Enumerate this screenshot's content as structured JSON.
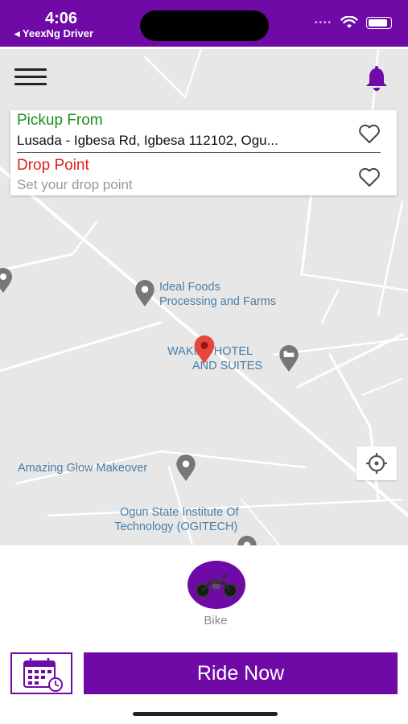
{
  "status_bar": {
    "time": "4:06",
    "back_app": "◂ YeexNg Driver"
  },
  "map": {
    "pickup": {
      "label": "Pickup From",
      "value": "Lusada - Igbesa Rd, Igbesa 112102, Ogu..."
    },
    "drop": {
      "label": "Drop Point",
      "placeholder": "Set your drop point"
    },
    "places": [
      {
        "line1": "Ideal Foods",
        "line2": "Processing and Farms"
      },
      {
        "line1": "WAKIAT HOTEL",
        "line2": "AND SUITES"
      },
      {
        "line1": "Amazing Glow Makeover"
      },
      {
        "line1": "Ogun State Institute Of",
        "line2": "Technology (OGITECH)"
      }
    ]
  },
  "vehicle": {
    "label": "Bike"
  },
  "actions": {
    "ride_now": "Ride Now"
  },
  "colors": {
    "brand": "#6f0aa6",
    "pickup": "#1a8f1a",
    "drop": "#e0201a",
    "map_label": "#4b7ea6"
  },
  "icons": [
    "menu-icon",
    "bell-icon",
    "heart-icon",
    "pin-icon",
    "hotel-icon",
    "locate-icon",
    "motorbike-icon",
    "calendar-icon"
  ]
}
